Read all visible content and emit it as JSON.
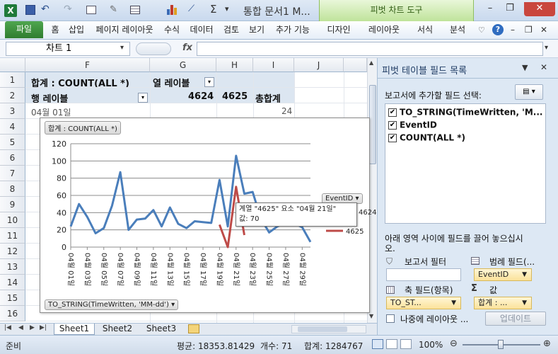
{
  "title": {
    "text": "통합 문서1 M...",
    "context_tab": "피벗 차트 도구"
  },
  "ribbon": {
    "file": "파일",
    "tabs": [
      "홈",
      "삽입",
      "페이지 레이아웃",
      "수식",
      "데이터",
      "검토",
      "보기",
      "추가 기능",
      "디자인",
      "레이아웃",
      "서식",
      "분석"
    ]
  },
  "formula_bar": {
    "name_box": "차트 1",
    "fx": "fx",
    "value": ""
  },
  "columns": [
    "F",
    "G",
    "H",
    "I",
    "J"
  ],
  "rows": [
    "1",
    "2",
    "3",
    "4",
    "5",
    "6",
    "7",
    "8",
    "9",
    "10",
    "11",
    "12",
    "13",
    "14",
    "15",
    "16"
  ],
  "pivot": {
    "row1_label": "합계 : COUNT(ALL *)",
    "row1_col": "열 레이블",
    "row2_label": "행 레이블",
    "row2_v1": "4624",
    "row2_v2": "4625",
    "row2_total": "총합계",
    "row3_peek": "04월 01일",
    "row3_peek_value": "24"
  },
  "chart": {
    "field_button": "합계 : COUNT(ALL *)",
    "axis_field_button": "TO_STRING(TimeWritten, 'MM-dd')",
    "legend_button": "EventID",
    "legend_hidden_label": "4624",
    "tooltip_line1": "계열 \"4625\" 요소 \"04월 21일\"",
    "tooltip_line2": "값: 70"
  },
  "chart_data": {
    "type": "line",
    "title": "",
    "ylim": [
      0,
      120
    ],
    "yticks": [
      "0",
      "20",
      "40",
      "60",
      "80",
      "100",
      "120"
    ],
    "xticks": [
      "04월 01일",
      "04월 03일",
      "04월 05일",
      "04월 07일",
      "04월 09일",
      "04월 11일",
      "04월 13일",
      "04월 15일",
      "04월 17일",
      "04월 19일",
      "04월 21일",
      "04월 23일",
      "04월 25일",
      "04월 27일",
      "04월 29일"
    ],
    "series": [
      {
        "name": "4624",
        "color": "#4a7ebb",
        "values": [
          24,
          50,
          35,
          16,
          22,
          48,
          87,
          20,
          32,
          33,
          43,
          24,
          46,
          27,
          22,
          30,
          29,
          28,
          78,
          24,
          106,
          62,
          64,
          33,
          17,
          24,
          28,
          28,
          23,
          6
        ]
      },
      {
        "name": "4625",
        "color": "#be4b48",
        "values": [
          null,
          null,
          null,
          null,
          null,
          null,
          null,
          null,
          null,
          null,
          null,
          null,
          null,
          null,
          null,
          null,
          null,
          null,
          26,
          0,
          70,
          14,
          null,
          null,
          null,
          null,
          null,
          null,
          null,
          null
        ]
      }
    ]
  },
  "sheet_tabs": [
    "Sheet1",
    "Sheet2",
    "Sheet3"
  ],
  "status": {
    "ready": "준비",
    "average": "평균: 18353.81429",
    "count": "개수: 71",
    "sum": "합계: 1284767",
    "zoom": "100%"
  },
  "panel": {
    "title": "피벗 테이블 필드 목록",
    "choose_label": "보고서에 추가할 필드 선택:",
    "fields": [
      {
        "label": "TO_STRING(TimeWritten, 'M...",
        "checked": true
      },
      {
        "label": "EventID",
        "checked": true
      },
      {
        "label": "COUNT(ALL *)",
        "checked": true
      }
    ],
    "drag_label": "아래 영역 사이에 필드를 끌어 놓으십시오.",
    "report_filter": "보고서 필터",
    "legend_fields": "범례 필드(...",
    "legend_value": "EventID",
    "axis_fields": "축 필드(항목)",
    "values_label": "값",
    "axis_value": "TO_ST...",
    "values_value": "합계 : ...",
    "defer_label": "나중에 레이아웃 ...",
    "update_button": "업데이트"
  }
}
